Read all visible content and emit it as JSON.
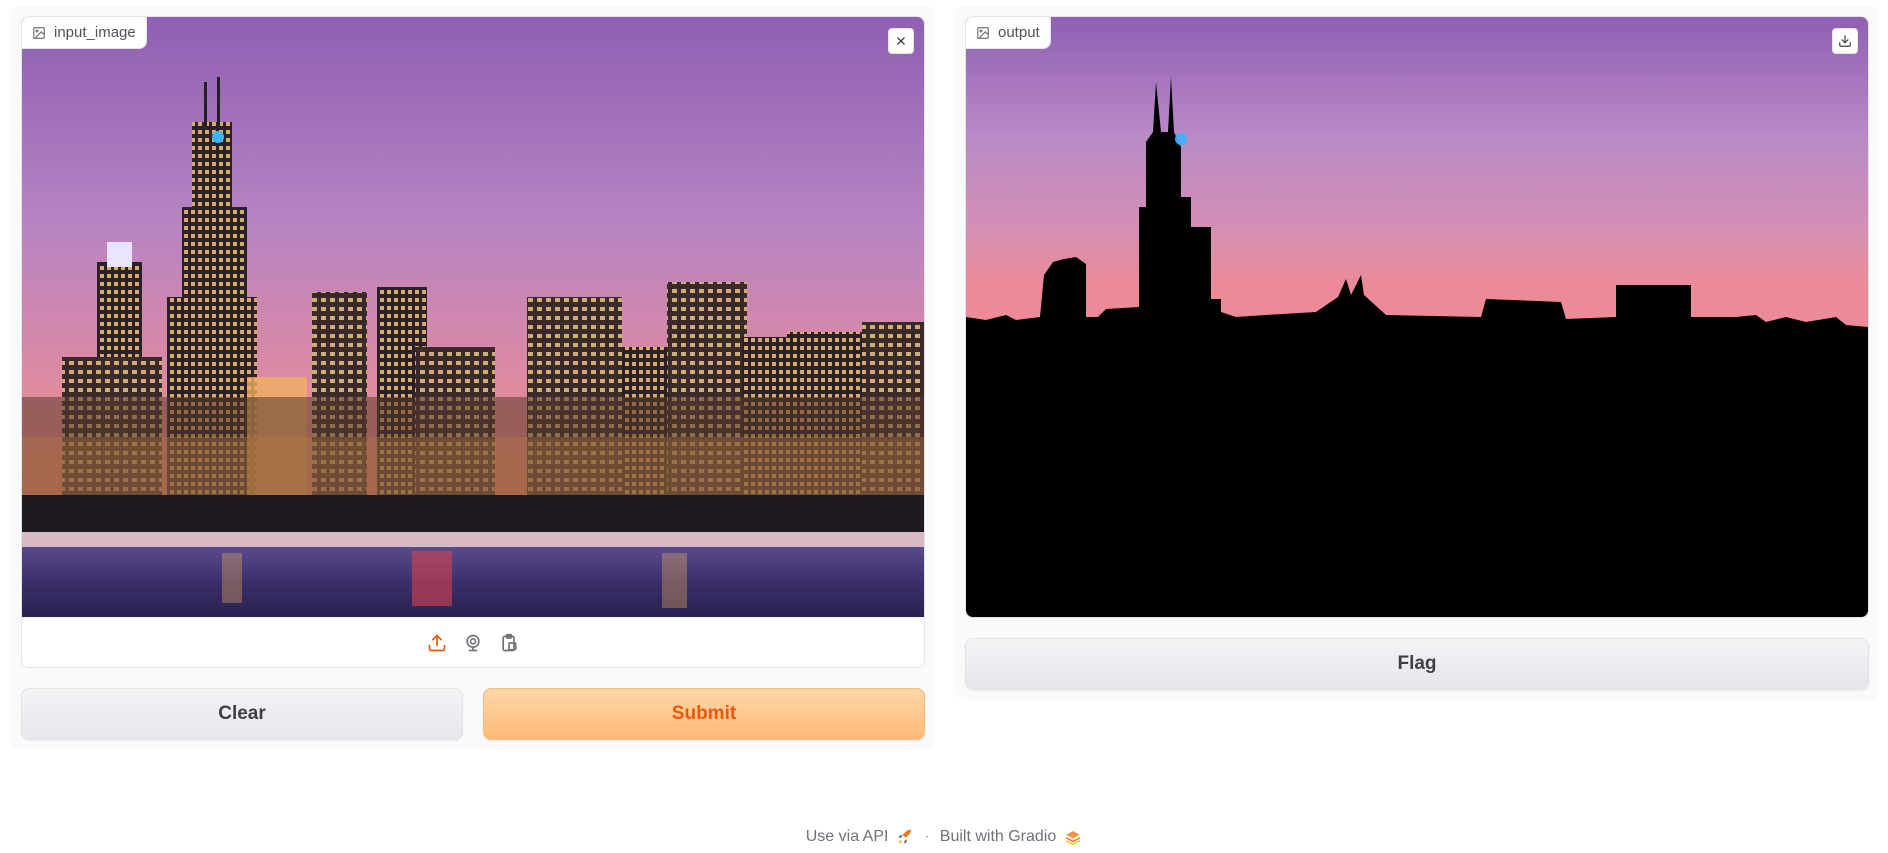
{
  "input": {
    "label": "input_image",
    "label_icon": "image-icon",
    "clear_icon": "close-icon",
    "sources": [
      {
        "icon": "upload-icon"
      },
      {
        "icon": "webcam-icon"
      },
      {
        "icon": "clipboard-icon"
      }
    ]
  },
  "output": {
    "label": "output",
    "label_icon": "image-icon",
    "download_icon": "download-icon"
  },
  "buttons": {
    "clear": "Clear",
    "submit": "Submit",
    "flag": "Flag"
  },
  "footer": {
    "api_label": "Use via API",
    "separator": "·",
    "built_label": "Built with Gradio"
  },
  "colors": {
    "accent": "#ea580c",
    "primary_bg": "#fdba74",
    "panel_bg": "#f9fafb"
  }
}
